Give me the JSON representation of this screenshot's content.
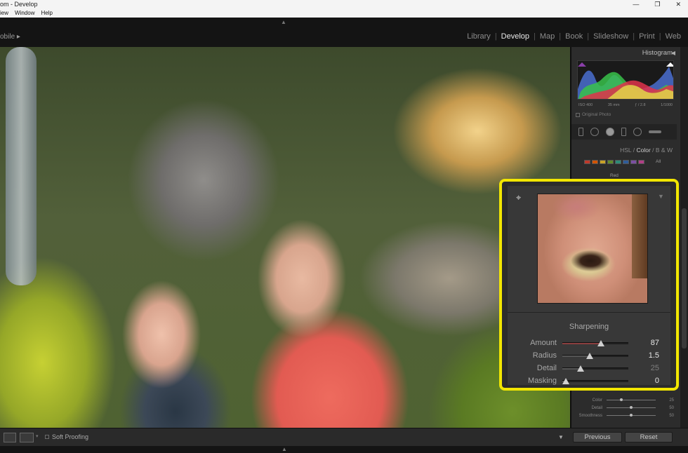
{
  "titlebar": {
    "title": "om - Develop",
    "buttons": [
      "—",
      "❐",
      "✕"
    ]
  },
  "menu": [
    "iew",
    "Window",
    "Help"
  ],
  "topbar": {
    "mobile_label": "obile ▸",
    "modules": [
      "Library",
      "Develop",
      "Map",
      "Book",
      "Slideshow",
      "Print",
      "Web"
    ],
    "active_module": "Develop"
  },
  "histogram": {
    "title": "Histogram",
    "info": {
      "iso": "ISO 400",
      "focal": "35 mm",
      "aperture": "ƒ / 2.8",
      "shutter": "1/1000"
    },
    "original_photo_label": "Original Photo"
  },
  "hsl": {
    "tabs": [
      "HSL",
      "/",
      "Color",
      "/",
      "B & W"
    ],
    "active_tab": "Color",
    "all_label": "All",
    "selected_color": "Red",
    "swatch_colors": [
      "#c0392b",
      "#d35400",
      "#c9a227",
      "#5f8a2a",
      "#2e8b77",
      "#2f5d9a",
      "#7b4fa2",
      "#b13e86"
    ]
  },
  "detail": {
    "section_title": "Sharpening",
    "sliders": [
      {
        "label": "Amount",
        "value": "87",
        "fraction": 0.58,
        "fill": "#8a3f3f",
        "dim": false
      },
      {
        "label": "Radius",
        "value": "1.5",
        "fraction": 0.42,
        "fill": "#555555",
        "dim": false
      },
      {
        "label": "Detail",
        "value": "25",
        "fraction": 0.28,
        "fill": "#555555",
        "dim": true
      },
      {
        "label": "Masking",
        "value": "0",
        "fraction": 0.05,
        "fill": "#555555",
        "dim": false
      }
    ]
  },
  "noise_reduction": {
    "rows": [
      {
        "label": "Color",
        "value": "25",
        "fraction": 0.3
      },
      {
        "label": "Detail",
        "value": "50",
        "fraction": 0.5
      },
      {
        "label": "Smoothness",
        "value": "50",
        "fraction": 0.5
      }
    ]
  },
  "toolbar": {
    "soft_proofing_label": "Soft Proofing"
  },
  "buttons": {
    "previous": "Previous",
    "reset": "Reset"
  },
  "colors": {
    "highlight": "#f2e600",
    "panel_bg": "#2c2c2c",
    "accent_active": "#e8e8e8"
  }
}
